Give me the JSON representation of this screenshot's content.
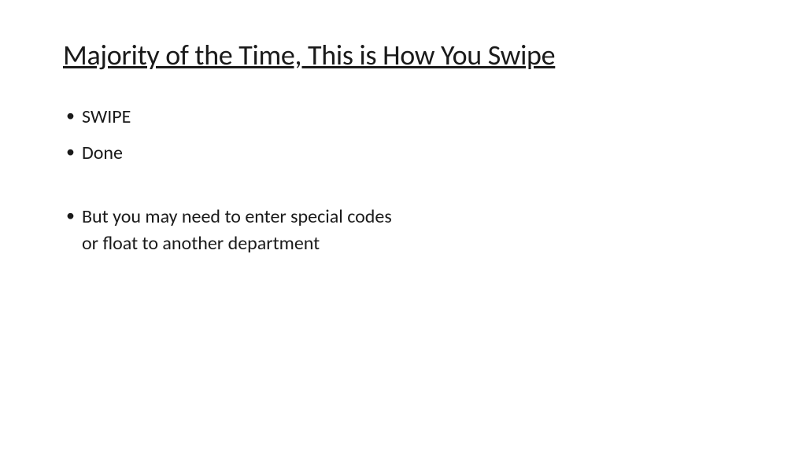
{
  "title": "Majority of the Time, This is How You Swipe",
  "bullets": {
    "item0": "SWIPE",
    "item1": "Done",
    "item2": "But you may need to enter special codes or float to another department"
  }
}
